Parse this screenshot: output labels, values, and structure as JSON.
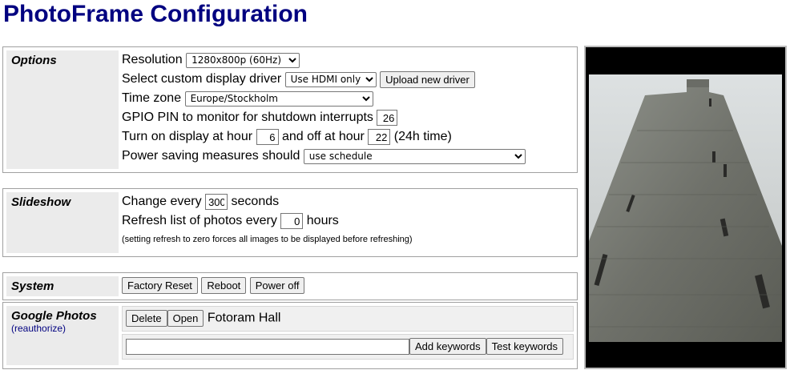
{
  "page": {
    "title": "PhotoFrame Configuration"
  },
  "options": {
    "heading": "Options",
    "resolution": {
      "label": "Resolution",
      "value": "1280x800p (60Hz)"
    },
    "driver": {
      "label": "Select custom display driver",
      "value": "Use HDMI only",
      "upload_button": "Upload new driver"
    },
    "timezone": {
      "label": "Time zone",
      "value": "Europe/Stockholm"
    },
    "gpio": {
      "label": "GPIO PIN to monitor for shutdown interrupts",
      "value": "26"
    },
    "display_hours": {
      "label_on": "Turn on display at hour",
      "on_value": "6",
      "label_off": "and off at hour",
      "off_value": "22",
      "suffix": "(24h time)"
    },
    "power_saving": {
      "label": "Power saving measures should",
      "value": "use schedule"
    }
  },
  "slideshow": {
    "heading": "Slideshow",
    "change": {
      "label": "Change every",
      "value": "300",
      "suffix": "seconds"
    },
    "refresh": {
      "label": "Refresh list of photos every",
      "value": "0",
      "suffix": "hours"
    },
    "note": "(setting refresh to zero forces all images to be displayed before refreshing)"
  },
  "system": {
    "heading": "System",
    "buttons": {
      "factory_reset": "Factory Reset",
      "reboot": "Reboot",
      "power_off": "Power off"
    }
  },
  "google": {
    "heading": "Google Photos",
    "reauth_link": "(reauthorize)",
    "delete_button": "Delete",
    "open_button": "Open",
    "album_name": "Fotoram Hall",
    "keywords_value": "",
    "add_keywords_button": "Add keywords",
    "test_keywords_button": "Test keywords"
  },
  "preview": {
    "icon": "stone-tower-photo"
  }
}
